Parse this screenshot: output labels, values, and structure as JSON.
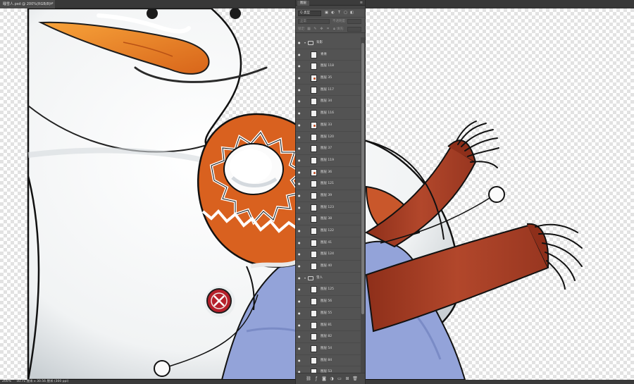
{
  "document_tab": {
    "title": "睡雪人.psd @ 200%(RGB/8) *",
    "close": "×"
  },
  "status_bar": {
    "zoom": "200%",
    "doc_size": "50.71 厘米 x 30.56 厘米 (300 ppi)"
  },
  "layers_panel": {
    "tab_label": "图层",
    "menu_icon": "≡",
    "filter_kind": "Q 类型",
    "blend_mode": "正常",
    "opacity_label": "不透明度:",
    "lock_label": "锁定:",
    "fill_label": "填充:",
    "filter_icons": [
      "image-filter-icon",
      "adjust-filter-icon",
      "text-filter-icon",
      "shape-filter-icon",
      "smart-filter-icon"
    ],
    "lock_icons": [
      "lock-pixels-icon",
      "lock-paint-icon",
      "lock-move-icon",
      "lock-artboard-icon",
      "lock-all-icon"
    ],
    "layers": [
      {
        "type": "group",
        "name": "背影"
      },
      {
        "type": "layer",
        "name": "青青"
      },
      {
        "type": "layer",
        "name": "图层 118"
      },
      {
        "type": "layer",
        "name": "图层 35"
      },
      {
        "type": "layer",
        "name": "图层 117"
      },
      {
        "type": "layer",
        "name": "图层 34"
      },
      {
        "type": "layer",
        "name": "图层 116"
      },
      {
        "type": "layer",
        "name": "图层 33"
      },
      {
        "type": "layer",
        "name": "图层 120"
      },
      {
        "type": "layer",
        "name": "图层 37"
      },
      {
        "type": "layer",
        "name": "图层 119"
      },
      {
        "type": "layer",
        "name": "图层 36"
      },
      {
        "type": "layer",
        "name": "图层 121"
      },
      {
        "type": "layer",
        "name": "图层 39"
      },
      {
        "type": "layer",
        "name": "图层 123"
      },
      {
        "type": "layer",
        "name": "图层 38"
      },
      {
        "type": "layer",
        "name": "图层 122"
      },
      {
        "type": "layer",
        "name": "图层 41"
      },
      {
        "type": "layer",
        "name": "图层 124"
      },
      {
        "type": "layer",
        "name": "图层 40"
      },
      {
        "type": "group",
        "name": "雪人"
      },
      {
        "type": "layer",
        "name": "图层 125"
      },
      {
        "type": "layer",
        "name": "图层 56"
      },
      {
        "type": "layer",
        "name": "图层 55"
      },
      {
        "type": "layer",
        "name": "图层 81"
      },
      {
        "type": "layer",
        "name": "图层 82"
      },
      {
        "type": "layer",
        "name": "图层 54"
      },
      {
        "type": "layer",
        "name": "图层 84"
      },
      {
        "type": "layer",
        "name": "图层 53"
      }
    ],
    "footer_icons": [
      "link-layers-icon",
      "fx-icon",
      "mask-icon",
      "adjustment-icon",
      "group-icon",
      "new-layer-icon",
      "trash-icon"
    ]
  }
}
